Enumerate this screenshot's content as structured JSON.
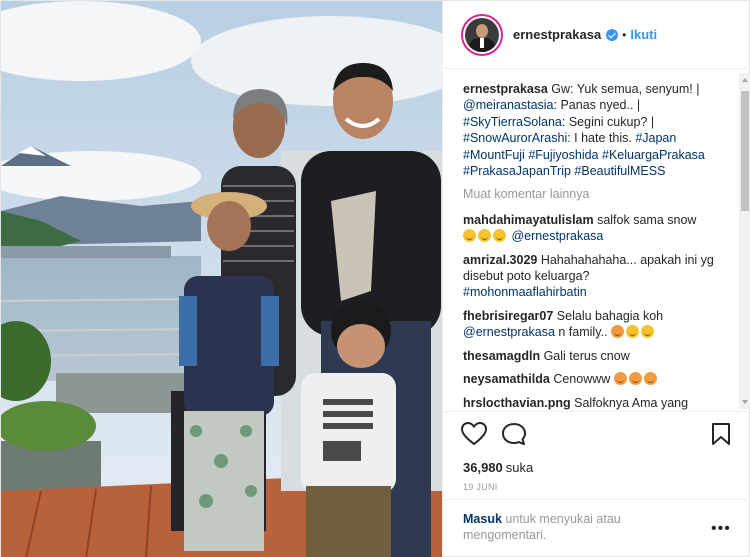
{
  "post": {
    "username": "ernestprakasa",
    "dot": "•",
    "follow_label": "Ikuti",
    "caption": {
      "user": "ernestprakasa",
      "p1": " Gw: Yuk semua, senyum! | ",
      "m1": "@meiranastasia",
      "p2": ": Panas nyed.. | ",
      "m2": "#SkyTierraSolana",
      "p3": ": Segini cukup? | ",
      "m3": "#SnowAurorArashi",
      "p4": ": I hate this. ",
      "t1": "#Japan",
      "t2": "#MountFuji",
      "t3": "#Fujiyoshida",
      "t4": "#KeluargaPrakasa",
      "t5": "#PrakasaJapanTrip",
      "t6": "#BeautifulMESS"
    },
    "more_comments": "Muat komentar lainnya",
    "comments": [
      {
        "user": "mahdahimayatulislam",
        "text": " salfok sama snow",
        "mention": "@ernestprakasa"
      },
      {
        "user": "amrizal.3029",
        "text": " Hahahahahaha... apakah ini yg disebut poto keluarga?",
        "tag": "#mohonmaaflahirbatin"
      },
      {
        "user": "fhebrisiregar07",
        "text": " Selalu bahagia koh",
        "mention": "@ernestprakasa",
        "text2": " n family.."
      },
      {
        "user": "thesamagdln",
        "text": " Gali terus cnow"
      },
      {
        "user": "neysamathilda",
        "text": " Cenowww"
      },
      {
        "user": "hrslocthavian.png",
        "text": " Salfoknya Ama yang"
      }
    ],
    "likes_count": "36,980",
    "likes_suffix": "suka",
    "date": "19 JUNI",
    "login_link": "Masuk",
    "login_text": " untuk menyukai atau mengomentari.",
    "menu": "•••"
  }
}
